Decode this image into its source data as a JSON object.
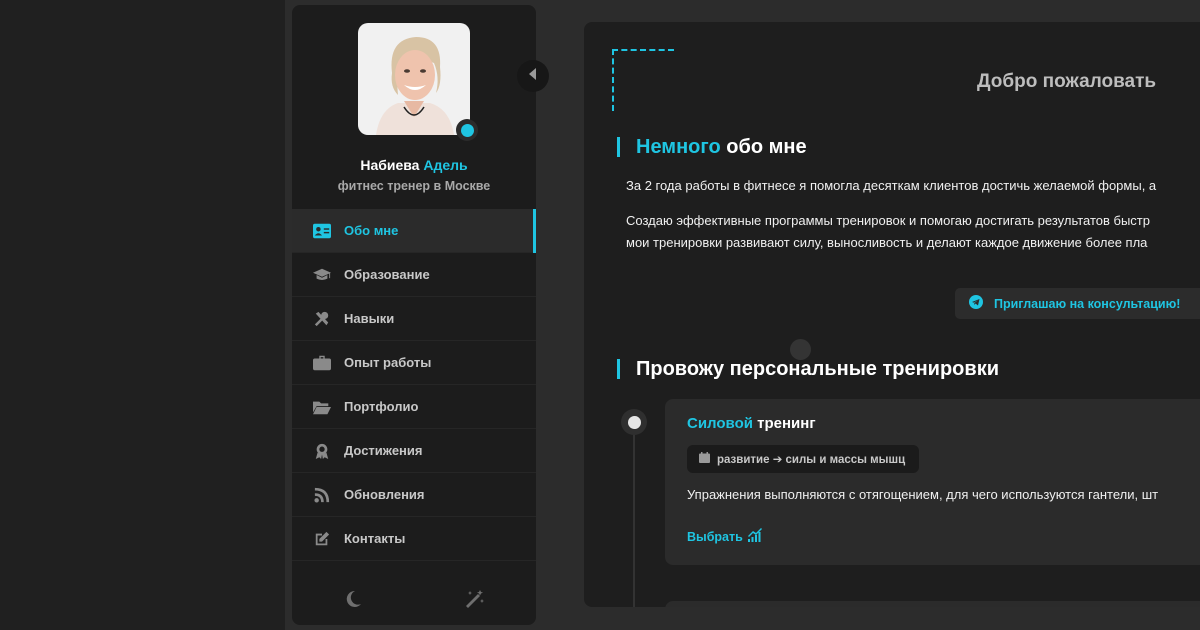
{
  "colors": {
    "accent": "#1fc5e2",
    "sidebar_bg": "#1c1c1c",
    "main_bg": "#1e1e1e",
    "card_bg": "#2b2b2b"
  },
  "profile": {
    "surname": "Набиева",
    "first_name": "Адель",
    "role": "фитнес тренер в Москве",
    "status": "online"
  },
  "nav": {
    "items": [
      {
        "label": "Обо мне",
        "icon": "id-card-icon",
        "active": true
      },
      {
        "label": "Образование",
        "icon": "graduation-cap-icon",
        "active": false
      },
      {
        "label": "Навыки",
        "icon": "tools-icon",
        "active": false
      },
      {
        "label": "Опыт работы",
        "icon": "briefcase-icon",
        "active": false
      },
      {
        "label": "Портфолио",
        "icon": "folder-open-icon",
        "active": false
      },
      {
        "label": "Достижения",
        "icon": "award-icon",
        "active": false
      },
      {
        "label": "Обновления",
        "icon": "rss-icon",
        "active": false
      },
      {
        "label": "Контакты",
        "icon": "edit-icon",
        "active": false
      }
    ],
    "footer": {
      "theme_icon": "moon-icon",
      "effects_icon": "magic-wand-icon"
    }
  },
  "main": {
    "welcome": "Добро пожаловать",
    "about": {
      "title_accent": "Немного",
      "title_rest": "обо мне",
      "paragraph1": "За 2 года работы в фитнесе я помогла десяткам клиентов достичь желаемой формы, а",
      "paragraph2_line1": "Создаю эффективные программы тренировок и помогаю достигать результатов быстр",
      "paragraph2_line2": "мои тренировки развивают силу, выносливость и делают каждое движение более пла",
      "consult_button": "Приглашаю на консультацию!"
    },
    "trainings": {
      "title": "Провожу персональные тренировки",
      "items": [
        {
          "title_accent": "Силовой",
          "title_rest": "тренинг",
          "tag": "развитие ➔ силы и массы мышц",
          "description": "Упражнения выполняются с отягощением, для чего используются гантели, шт",
          "link": "Выбрать"
        }
      ]
    }
  }
}
